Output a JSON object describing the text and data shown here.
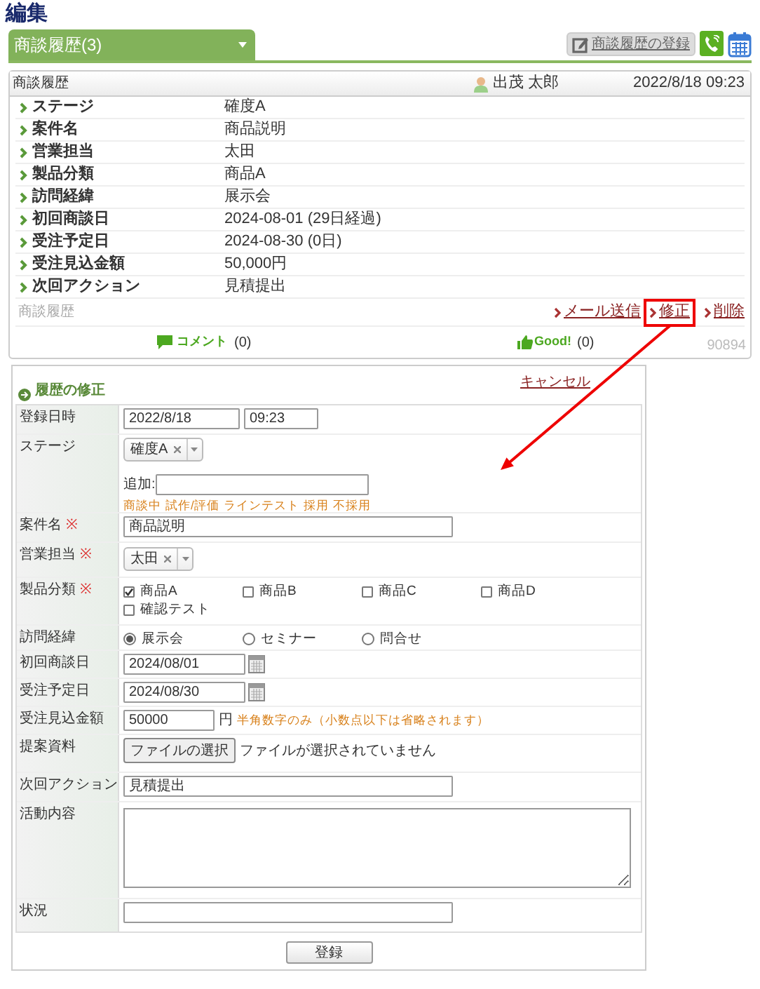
{
  "page_title": "編集",
  "tab": {
    "label": "商談履歴(3)"
  },
  "toolbar": {
    "register_button": "商談履歴の登録"
  },
  "history_card": {
    "title": "商談履歴",
    "user": "出茂 太郎",
    "datetime": "2022/8/18 09:23",
    "fields": [
      {
        "label": "ステージ",
        "value": "確度A"
      },
      {
        "label": "案件名",
        "value": "商品説明"
      },
      {
        "label": "営業担当",
        "value": "太田"
      },
      {
        "label": "製品分類",
        "value": "商品A"
      },
      {
        "label": "訪問経緯",
        "value": "展示会"
      },
      {
        "label": "初回商談日",
        "value": "2024-08-01 (29日経過)"
      },
      {
        "label": "受注予定日",
        "value": "2024-08-30 (0日)"
      },
      {
        "label": "受注見込金額",
        "value": "50,000円"
      },
      {
        "label": "次回アクション",
        "value": "見積提出"
      }
    ],
    "breadcrumb": "商談履歴",
    "actions": [
      {
        "label": "メール送信",
        "highlighted": false
      },
      {
        "label": "修正",
        "highlighted": true
      },
      {
        "label": "削除",
        "highlighted": false
      }
    ],
    "comment": {
      "label": "コメント",
      "count": "(0)"
    },
    "good": {
      "label": "Good!",
      "count": "(0)"
    },
    "record_id": "90894"
  },
  "form": {
    "title": "履歴の修正",
    "cancel": "キャンセル",
    "submit": "登録",
    "rows": [
      {
        "kind": "datetime",
        "label": "登録日時",
        "date": "2022/8/18",
        "time": "09:23"
      },
      {
        "kind": "stage",
        "label": "ステージ",
        "chip": "確度A",
        "add_label": "追加:",
        "options": [
          "商談中",
          "試作/評価",
          "ラインテスト",
          "採用",
          "不採用"
        ]
      },
      {
        "kind": "text",
        "label": "案件名",
        "mark": "※",
        "value": "商品説明"
      },
      {
        "kind": "select",
        "label": "営業担当",
        "mark": "※",
        "chip": "太田"
      },
      {
        "kind": "checkboxes",
        "label": "製品分類",
        "mark": "※",
        "options": [
          {
            "label": "商品A",
            "checked": true
          },
          {
            "label": "商品B",
            "checked": false
          },
          {
            "label": "商品C",
            "checked": false
          },
          {
            "label": "商品D",
            "checked": false
          },
          {
            "label": "確認テスト",
            "checked": false
          }
        ]
      },
      {
        "kind": "radios",
        "label": "訪問経緯",
        "options": [
          {
            "label": "展示会",
            "selected": true
          },
          {
            "label": "セミナー",
            "selected": false
          },
          {
            "label": "問合せ",
            "selected": false
          }
        ]
      },
      {
        "kind": "date",
        "label": "初回商談日",
        "value": "2024/08/01"
      },
      {
        "kind": "date",
        "label": "受注予定日",
        "value": "2024/08/30"
      },
      {
        "kind": "amount",
        "label": "受注見込金額",
        "value": "50000",
        "unit": "円",
        "note": "半角数字のみ（小数点以下は省略されます）"
      },
      {
        "kind": "file",
        "label": "提案資料",
        "button": "ファイルの選択",
        "status": "ファイルが選択されていません"
      },
      {
        "kind": "text",
        "label": "次回アクション",
        "value": "見積提出"
      },
      {
        "kind": "textarea",
        "label": "活動内容"
      },
      {
        "kind": "text",
        "label": "状況",
        "value": ""
      }
    ]
  }
}
